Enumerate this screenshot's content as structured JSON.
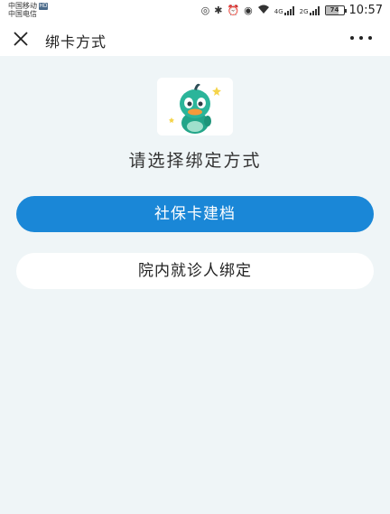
{
  "status_bar": {
    "carrier_1": "中国移动",
    "carrier_2": "中国电信",
    "hd_badge": "HD",
    "signal_1": "4G",
    "signal_2": "2G",
    "battery": "74",
    "battery_level": 0.74,
    "time": "10:57",
    "icons": [
      "nfc-icon",
      "bluetooth-icon",
      "alarm-icon",
      "eye-icon",
      "wifi-icon",
      "signal-icon",
      "signal-icon",
      "battery-icon"
    ]
  },
  "nav": {
    "title": "绑卡方式",
    "close_icon": "close-icon",
    "more_icon": "more-icon"
  },
  "main": {
    "prompt": "请选择绑定方式",
    "options": [
      {
        "label": "社保卡建档"
      },
      {
        "label": "院内就诊人绑定"
      }
    ]
  },
  "colors": {
    "primary": "#1a87d7",
    "background": "#eff5f7",
    "mascot": "#2bb59a"
  }
}
